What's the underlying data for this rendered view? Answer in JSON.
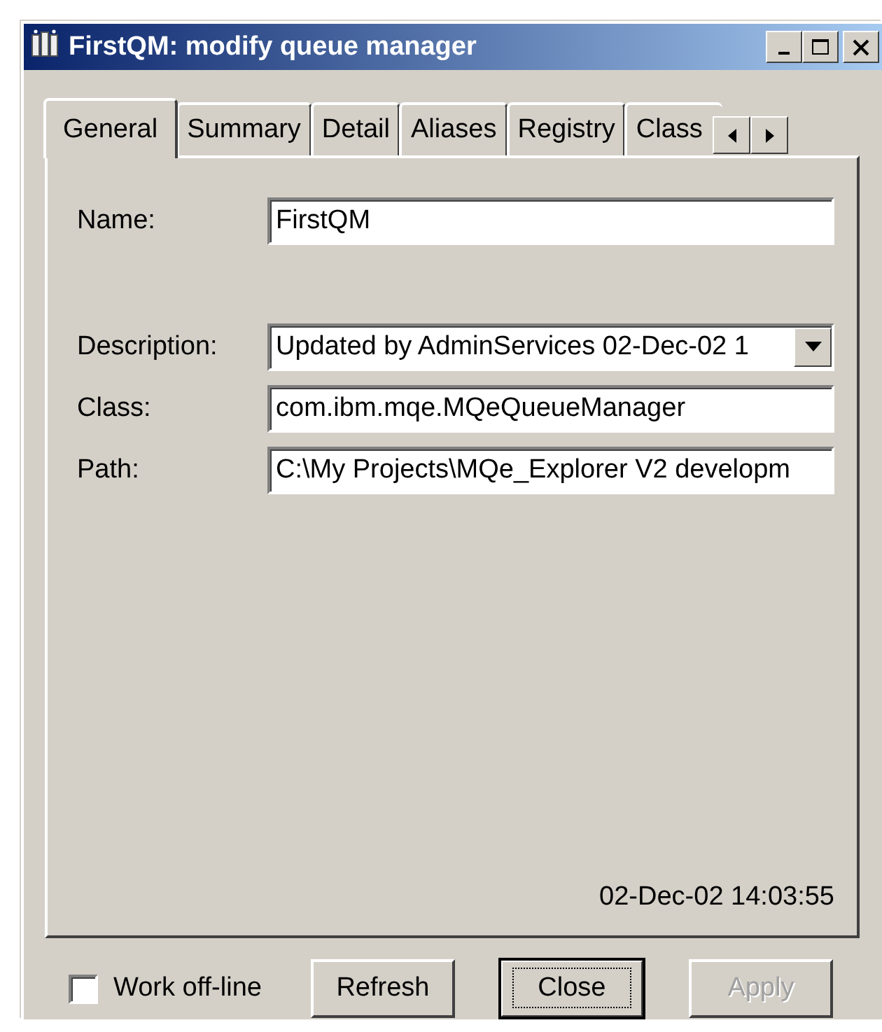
{
  "window": {
    "title": "FirstQM: modify queue manager"
  },
  "tabs": [
    {
      "label": "General",
      "selected": true
    },
    {
      "label": "Summary",
      "selected": false
    },
    {
      "label": "Detail",
      "selected": false
    },
    {
      "label": "Aliases",
      "selected": false
    },
    {
      "label": "Registry",
      "selected": false
    },
    {
      "label": "Class",
      "selected": false
    }
  ],
  "fields": [
    {
      "label": "Name:",
      "value": "FirstQM",
      "kind": "text"
    },
    {
      "label": "Description:",
      "value": "Updated by AdminServices 02-Dec-02 1",
      "kind": "dropdown"
    },
    {
      "label": "Class:",
      "value": "com.ibm.mqe.MQeQueueManager",
      "kind": "text"
    },
    {
      "label": "Path:",
      "value": "C:\\My Projects\\MQe_Explorer V2 developm",
      "kind": "text"
    }
  ],
  "timestamp": "02-Dec-02 14:03:55",
  "work_offline": {
    "label": "Work off-line",
    "checked": false
  },
  "buttons": [
    {
      "label": "Refresh",
      "default": false,
      "disabled": false
    },
    {
      "label": "Close",
      "default": true,
      "disabled": false
    },
    {
      "label": "Apply",
      "default": false,
      "disabled": true
    }
  ]
}
